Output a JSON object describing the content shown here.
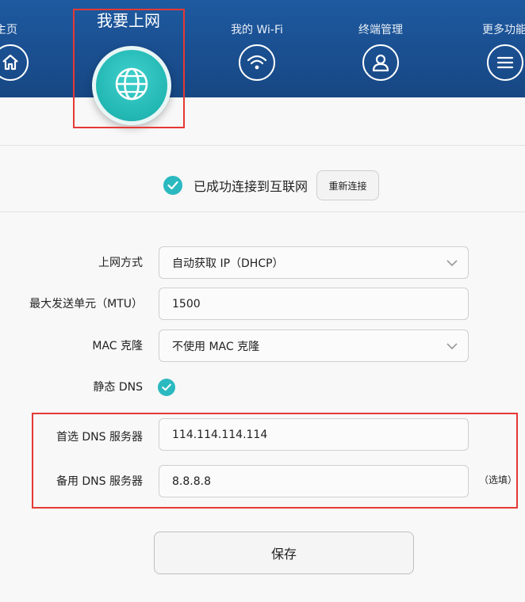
{
  "nav": {
    "home_label": "主页",
    "internet_label": "我要上网",
    "wifi_label": "我的 Wi-Fi",
    "terminal_label": "终端管理",
    "more_label": "更多功能"
  },
  "status": {
    "text": "已成功连接到互联网",
    "reconnect_label": "重新连接"
  },
  "form": {
    "connection_type": {
      "label": "上网方式",
      "value": "自动获取 IP（DHCP）"
    },
    "mtu": {
      "label": "最大发送单元（MTU）",
      "value": "1500"
    },
    "mac_clone": {
      "label": "MAC 克隆",
      "value": "不使用 MAC 克隆"
    },
    "static_dns": {
      "label": "静态 DNS",
      "checked": true
    },
    "primary_dns": {
      "label": "首选 DNS 服务器",
      "value": "114.114.114.114"
    },
    "secondary_dns": {
      "label": "备用 DNS 服务器",
      "value": "8.8.8.8",
      "note": "（选填）"
    }
  },
  "actions": {
    "save_label": "保存"
  },
  "colors": {
    "nav_bg": "#1a4f90",
    "accent_teal": "#2bb9c0",
    "highlight_red": "#e53935"
  },
  "icons": {
    "home": "home-icon",
    "internet": "globe-icon",
    "wifi": "wifi-icon",
    "terminal": "user-icon",
    "more": "menu-icon",
    "status": "check-icon",
    "select": "chevron-down-icon"
  }
}
